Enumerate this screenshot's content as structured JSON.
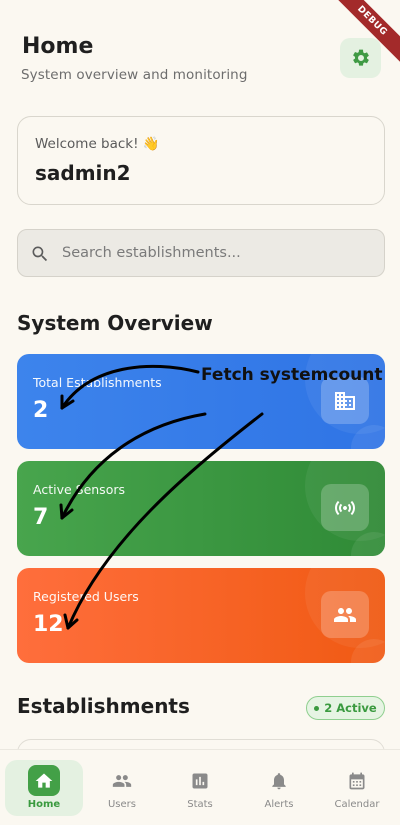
{
  "header": {
    "title": "Home",
    "subtitle": "System overview and monitoring",
    "settings_icon": "gear-icon"
  },
  "debug_banner": "DEBUG",
  "welcome": {
    "label": "Welcome back! 👋",
    "username": "sadmin2"
  },
  "search": {
    "placeholder": "Search establishments..."
  },
  "system_overview": {
    "title": "System Overview",
    "cards": [
      {
        "label": "Total Establishments",
        "value": "2",
        "icon": "building-icon",
        "color": "#3a7fea"
      },
      {
        "label": "Active Sensors",
        "value": "7",
        "icon": "sensor-icon",
        "color": "#3f9a44"
      },
      {
        "label": "Registered Users",
        "value": "12",
        "icon": "users-icon",
        "color": "#f8651f"
      }
    ]
  },
  "establishments": {
    "title": "Establishments",
    "badge": "2 Active"
  },
  "annotation": {
    "text": "Fetch systemcount"
  },
  "bottom_nav": {
    "items": [
      {
        "label": "Home",
        "icon": "home-icon",
        "active": true
      },
      {
        "label": "Users",
        "icon": "users-icon",
        "active": false
      },
      {
        "label": "Stats",
        "icon": "stats-icon",
        "active": false
      },
      {
        "label": "Alerts",
        "icon": "bell-icon",
        "active": false
      },
      {
        "label": "Calendar",
        "icon": "calendar-icon",
        "active": false
      }
    ]
  },
  "colors": {
    "accent_green": "#43a047",
    "background": "#fbf8f1"
  }
}
